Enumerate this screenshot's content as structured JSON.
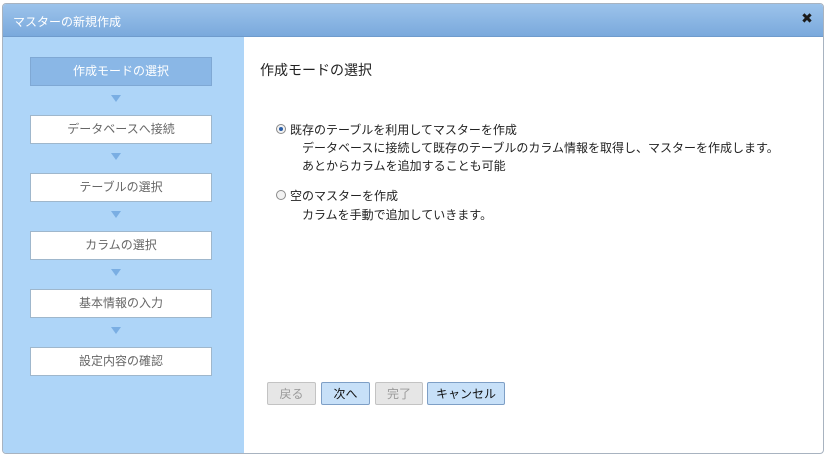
{
  "dialog": {
    "title": "マスターの新規作成",
    "close_symbol": "✖"
  },
  "sidebar": {
    "steps": [
      {
        "label": "作成モードの選択",
        "active": true
      },
      {
        "label": "データベースへ接続",
        "active": false
      },
      {
        "label": "テーブルの選択",
        "active": false
      },
      {
        "label": "カラムの選択",
        "active": false
      },
      {
        "label": "基本情報の入力",
        "active": false
      },
      {
        "label": "設定内容の確認",
        "active": false
      }
    ],
    "arrow_icon": "down-triangle"
  },
  "main": {
    "heading": "作成モードの選択",
    "options": [
      {
        "label": "既存のテーブルを利用してマスターを作成",
        "checked": true,
        "desc_line1": "データベースに接続して既存のテーブルのカラム情報を取得し、マスターを作成します。",
        "desc_line2": "あとからカラムを追加することも可能"
      },
      {
        "label": "空のマスターを作成",
        "checked": false,
        "desc_line1": "カラムを手動で追加していきます。"
      }
    ]
  },
  "buttons": {
    "back": {
      "label": "戻る",
      "disabled": true
    },
    "next": {
      "label": "次へ",
      "disabled": false
    },
    "finish": {
      "label": "完了",
      "disabled": true
    },
    "cancel": {
      "label": "キャンセル",
      "disabled": false
    }
  },
  "colors": {
    "titlebar": "#8ab7e6",
    "sidebar": "#aed5f8",
    "active_step": "#8ab7e6",
    "button": "#c7e0f8"
  }
}
